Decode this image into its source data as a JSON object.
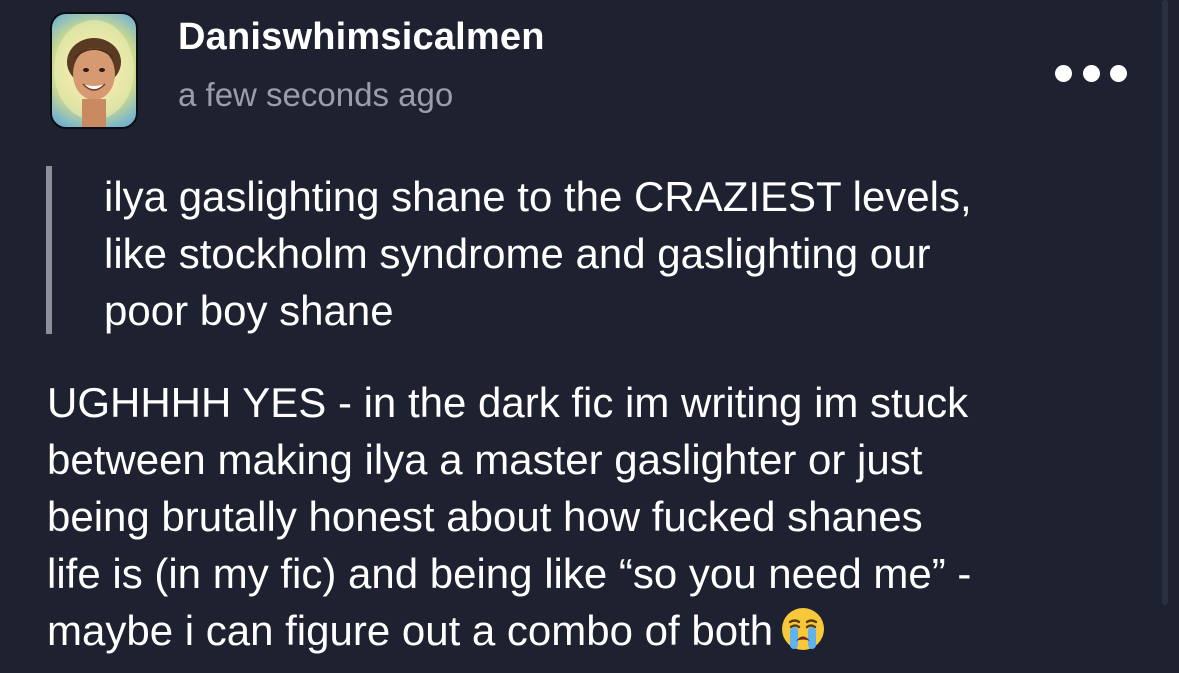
{
  "post": {
    "username": "Daniswhimsicalmen",
    "timestamp": "a few seconds ago",
    "quote_lines": [
      "ilya gaslighting shane to the CRAZIEST levels,",
      "like stockholm syndrome and gaslighting our",
      "poor boy shane"
    ],
    "reply_lines": [
      "UGHHHH YES - in the dark fic im writing im stuck",
      "between making ilya a master gaslighter or just",
      "being brutally honest about how fucked shanes",
      "life is (in my fic) and being like “so you need me” -",
      "maybe i can figure out a combo of both"
    ],
    "reply_emoji": "crying-face-icon"
  },
  "colors": {
    "background": "#1e2230",
    "text": "#ffffff",
    "timestamp": "#9a9ea8",
    "quote_bar": "#8b8f99"
  }
}
